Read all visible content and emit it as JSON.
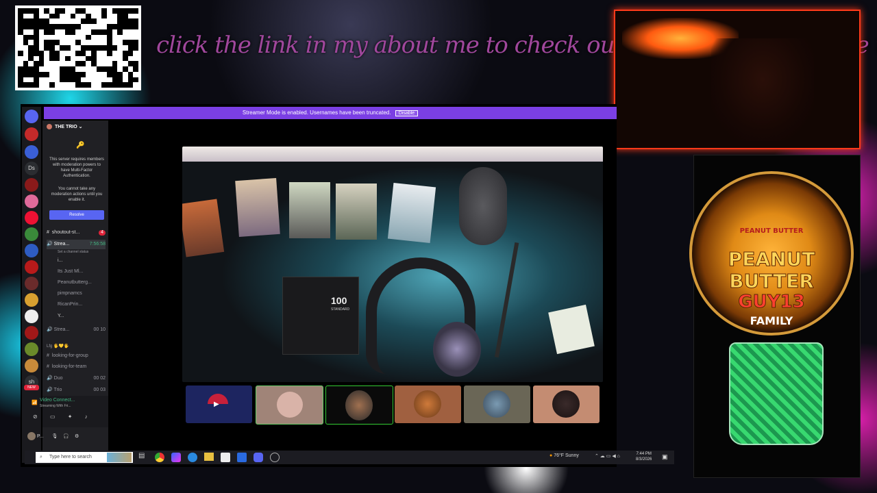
{
  "overlay": {
    "banner_text": "click the link in my about me to check out a quick an easy come up!",
    "logo": {
      "line1": "PEANUT",
      "line2": "BUTTER",
      "line3": "GUY13",
      "line4": "FAMILY",
      "jar_label": "PEANUT BUTTER"
    }
  },
  "discord": {
    "streamer_banner": "Streamer Mode is enabled. Usernames have been truncated.",
    "disable_label": "Disable",
    "server_rail": [
      {
        "label": "Ds"
      },
      {
        "label": "sh"
      },
      {
        "label": "NEW"
      }
    ],
    "server": {
      "name": "THE TRIO",
      "mfa_notice": "This server requires members with moderation powers to have Multi-Factor Authentication.",
      "mfa_notice2": "You cannot take any moderation actions until you enable it.",
      "resolve_label": "Resolve"
    },
    "channels": [
      {
        "name": "shoutout-st...",
        "badge": "4"
      },
      {
        "name": "Strea...",
        "time": "7:56:58",
        "status": "Set a channel status"
      },
      {
        "name": "i..."
      },
      {
        "name": "Its Just Ml..."
      },
      {
        "name": "Peanutbutterg..."
      },
      {
        "name": "pimpnamcs"
      },
      {
        "name": "RicanPrin..."
      },
      {
        "name": "Y..."
      },
      {
        "name": "Strea...",
        "counts": [
          "00",
          "10"
        ]
      },
      {
        "name": "Lfg 🖐️💛🖐️"
      },
      {
        "name": "looking-for-group"
      },
      {
        "name": "looking-for-team"
      },
      {
        "name": "Duo",
        "counts": [
          "00",
          "02"
        ]
      },
      {
        "name": "Trio",
        "counts": [
          "00",
          "03"
        ]
      }
    ],
    "voice": {
      "status": "Video Connect...",
      "sub": "Streaming With Fri..."
    },
    "user": {
      "name": "P..."
    },
    "stream_tiles": [
      {
        "name": "tile-1"
      },
      {
        "name": "tile-2"
      },
      {
        "name": "tile-3"
      },
      {
        "name": "tile-4"
      },
      {
        "name": "tile-5"
      },
      {
        "name": "tile-6"
      }
    ],
    "cards_box_label": "100",
    "cards_box_sub": "STANDARD"
  },
  "taskbar": {
    "search_placeholder": "Type here to search",
    "weather": "76°F  Sunny",
    "time": "7:44 PM",
    "date": "8/3/2026"
  },
  "colors": {
    "accent": "#7b3fe4",
    "cam_border": "#ff3a1a",
    "banner_text": "#a0479c"
  }
}
